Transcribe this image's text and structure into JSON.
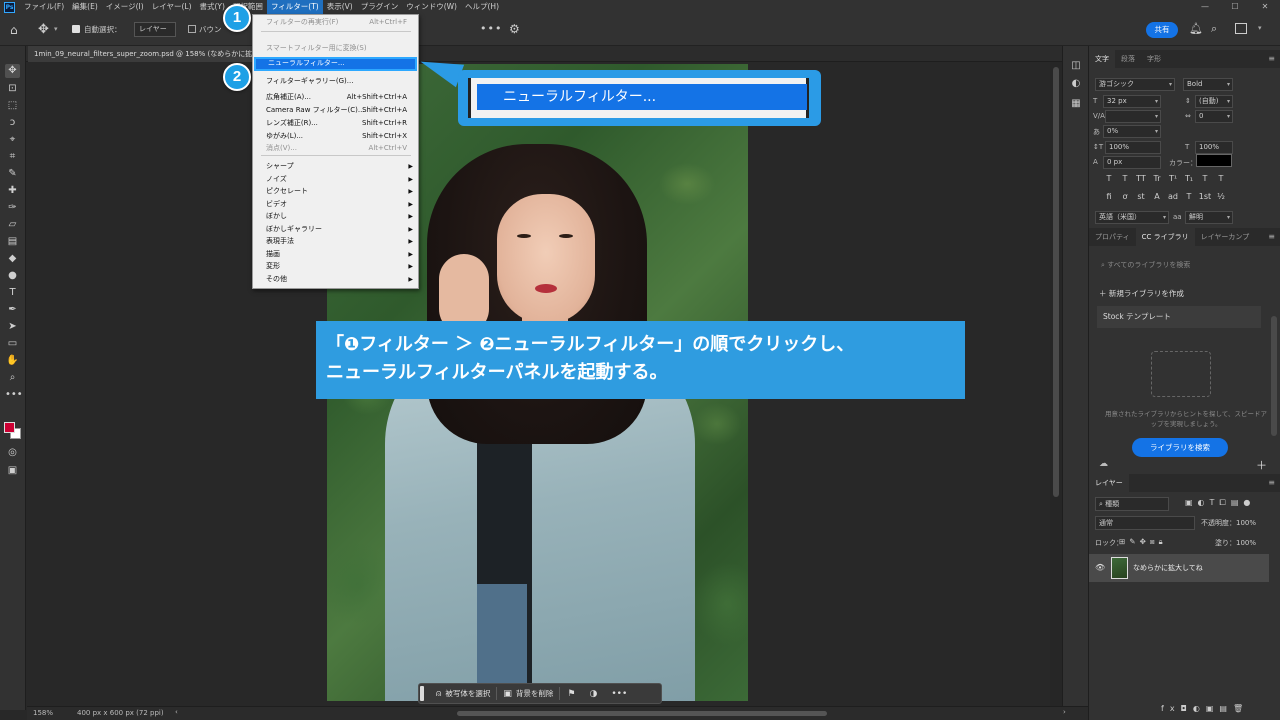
{
  "menubar": {
    "items": [
      "ファイル(F)",
      "編集(E)",
      "イメージ(I)",
      "レイヤー(L)",
      "書式(Y)",
      "選択範囲",
      "フィルター(T)",
      "表示(V)",
      "プラグイン",
      "ウィンドウ(W)",
      "ヘルプ(H)"
    ],
    "active_index": 6,
    "window_buttons": [
      "—",
      "☐",
      "✕"
    ]
  },
  "optionsbar": {
    "auto_select_label": "自動選択：",
    "layer_select_value": "レイヤー",
    "bbox_label": "バウン",
    "share_label": "共有"
  },
  "document": {
    "tab_title": "1min_09_neural_filters_super_zoom.psd @ 158% (なめらかに拡大..."
  },
  "filter_menu": {
    "items": [
      {
        "label": "フィルターの再実行(F)",
        "shortcut": "Alt+Ctrl+F",
        "disabled": true
      },
      {
        "label": "スマートフィルター用に変換(S)",
        "shortcut": "",
        "disabled": true
      },
      {
        "label": "ニューラルフィルター...",
        "shortcut": "",
        "highlight": true
      },
      {
        "label": "フィルターギャラリー(G)...",
        "shortcut": ""
      },
      {
        "label": "広角補正(A)...",
        "shortcut": "Alt+Shift+Ctrl+A"
      },
      {
        "label": "Camera Raw フィルター(C)...",
        "shortcut": "Shift+Ctrl+A"
      },
      {
        "label": "レンズ補正(R)...",
        "shortcut": "Shift+Ctrl+R"
      },
      {
        "label": "ゆがみ(L)...",
        "shortcut": "Shift+Ctrl+X"
      },
      {
        "label": "消点(V)...",
        "shortcut": "Alt+Ctrl+V",
        "disabled": true
      },
      {
        "label": "シャープ",
        "submenu": true
      },
      {
        "label": "ノイズ",
        "submenu": true
      },
      {
        "label": "ピクセレート",
        "submenu": true
      },
      {
        "label": "ビデオ",
        "submenu": true
      },
      {
        "label": "ぼかし",
        "submenu": true
      },
      {
        "label": "ぼかしギャラリー",
        "submenu": true
      },
      {
        "label": "表現手法",
        "submenu": true
      },
      {
        "label": "描画",
        "submenu": true
      },
      {
        "label": "変形",
        "submenu": true
      },
      {
        "label": "その他",
        "submenu": true
      }
    ]
  },
  "callouts": {
    "badge1": "1",
    "badge2": "2",
    "zoom_label": "ニューラルフィルター...",
    "instruction_line1": "「❶フィルター ＞ ❷ニューラルフィルター」の順でクリックし、",
    "instruction_line2": "ニューラルフィルターパネルを起動する。"
  },
  "taskbar": {
    "select_subject": "被写体を選択",
    "remove_bg": "背景を削除",
    "more": "•••"
  },
  "statusbar": {
    "zoom": "158%",
    "dimensions": "400 px x 600 px (72 ppi)"
  },
  "character_panel": {
    "tabs": [
      "文字",
      "段落",
      "字形"
    ],
    "font_family": "游ゴシック",
    "font_style": "Bold",
    "font_size": "32 px",
    "leading": "(自動)",
    "kerning_label": "V/A",
    "tracking": "0",
    "tsume": "0%",
    "vscale": "100%",
    "hscale": "100%",
    "baseline": "0 px",
    "color_label": "カラー：",
    "format_buttons": [
      "T",
      "T",
      "TT",
      "Tr",
      "T¹",
      "T₁",
      "T",
      "T"
    ],
    "format_buttons2": [
      "fi",
      "ơ",
      "st",
      "A",
      "ad",
      "T",
      "1st",
      "½"
    ],
    "language": "英語（米国）",
    "aa_label": "aa",
    "aa_value": "鮮明"
  },
  "library_panel": {
    "tabs": [
      "プロパティ",
      "CC ライブラリ",
      "レイヤーカンプ"
    ],
    "search_placeholder": "すべてのライブラリを検索",
    "new_library": "新規ライブラリを作成",
    "stock": "Stock テンプレート",
    "empty_msg": "用意されたライブラリからヒントを探して、スピードアップを実現しましょう。",
    "search_button": "ライブラリを検索"
  },
  "layers_panel": {
    "tab": "レイヤー",
    "filter_value": "種類",
    "blend_mode": "通常",
    "opacity_label": "不透明度：100%",
    "lock_label": "ロック：",
    "fill_label": "塗り：100%",
    "layer_name": "なめらかに拡大してね"
  }
}
